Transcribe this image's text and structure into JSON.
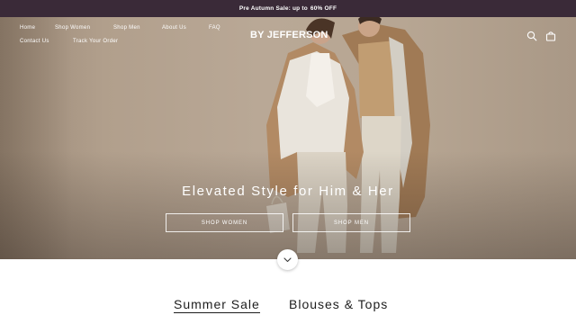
{
  "announcement": {
    "text": "Pre Autumn Sale: up to",
    "highlight": "60% OFF"
  },
  "nav": {
    "row1": [
      "Home",
      "Shop Women",
      "Shop Men",
      "About Us",
      "FAQ"
    ],
    "row2": [
      "Contact Us",
      "Track Your Order"
    ]
  },
  "logo": "BY JEFFERSON",
  "icons": {
    "search": "search-icon",
    "cart": "bag-icon",
    "scroll": "chevron-down-icon"
  },
  "hero": {
    "title": "Elevated Style for Him & Her",
    "buttons": [
      "SHOP WOMEN",
      "SHOP MEN"
    ]
  },
  "tabs": {
    "items": [
      "Summer Sale",
      "Blouses & Tops"
    ],
    "active": 0
  },
  "colors": {
    "announcement_bg": "#3a2a38",
    "text_dark": "#1d1d1d",
    "hero_bg": "#b5a491"
  }
}
